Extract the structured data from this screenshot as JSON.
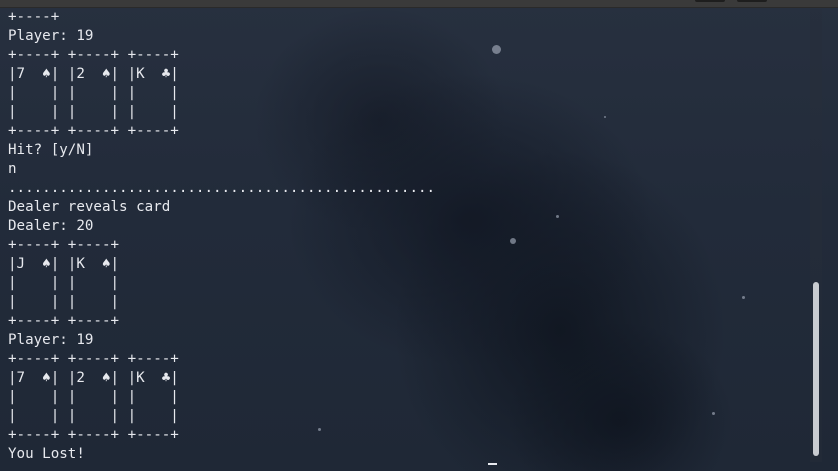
{
  "terminal": {
    "lines": [
      "+----+",
      "Player: 19",
      "+----+ +----+ +----+",
      "|7  ♠| |2  ♠| |K  ♣|",
      "|    | |    | |    |",
      "|    | |    | |    |",
      "+----+ +----+ +----+",
      "Hit? [y/N]",
      "n",
      "..................................................",
      "Dealer reveals card",
      "Dealer: 20",
      "+----+ +----+",
      "|J  ♠| |K  ♠|",
      "|    | |    |",
      "|    | |    |",
      "+----+ +----+",
      "Player: 19",
      "+----+ +----+ +----+",
      "|7  ♠| |2  ♠| |K  ♣|",
      "|    | |    | |    |",
      "|    | |    | |    |",
      "+----+ +----+ +----+",
      "You Lost!"
    ]
  }
}
